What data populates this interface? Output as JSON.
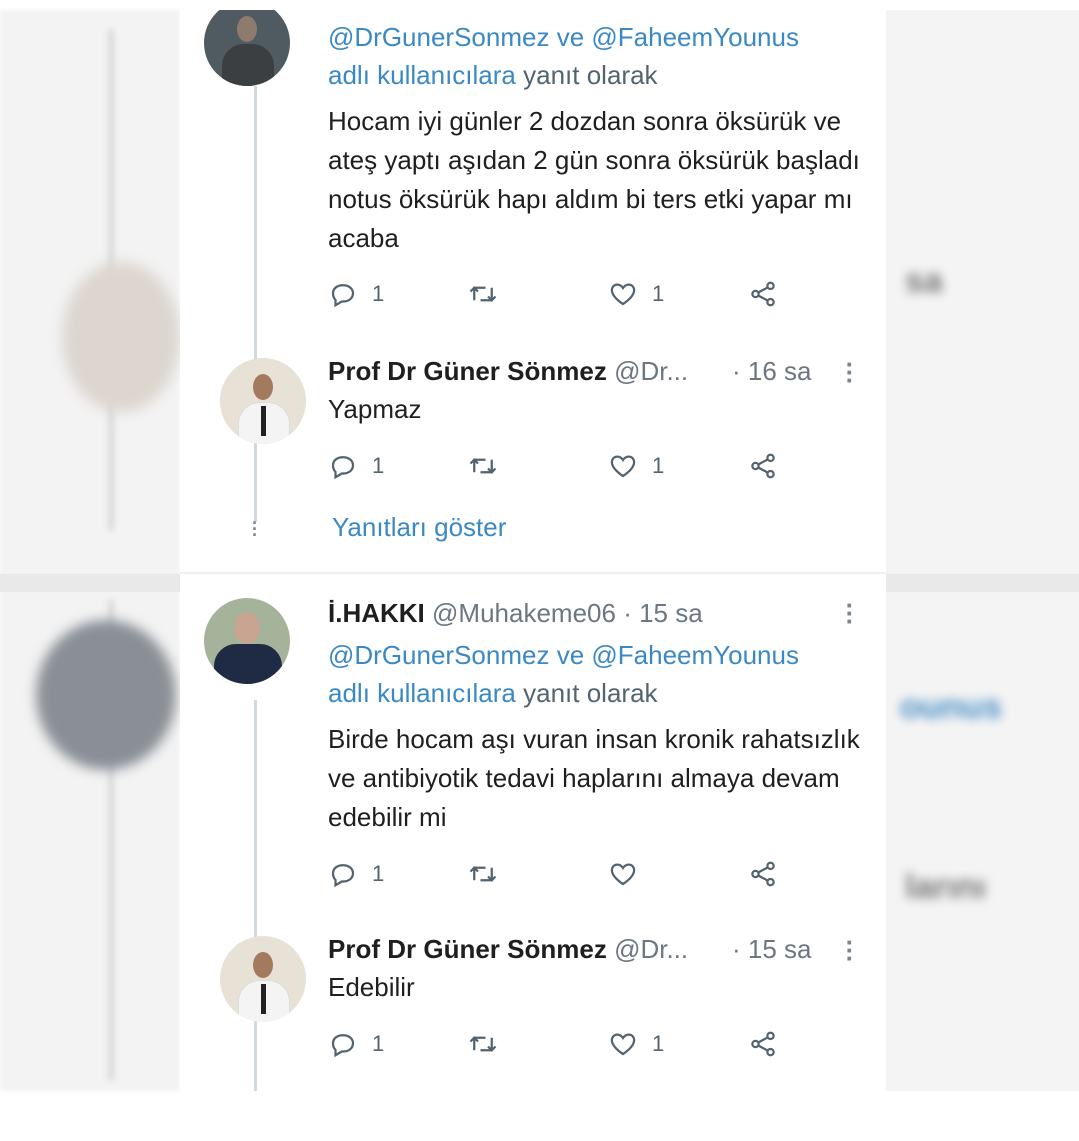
{
  "colors": {
    "link": "#3b89c4",
    "text": "#1f1f1f",
    "muted": "#536471"
  },
  "tweet1": {
    "reply_to_mentions": "@DrGunerSonmez ve @FaheemYounus",
    "reply_to_users": "adlı kullanıcılara",
    "reply_to_suffix": "yanıt olarak",
    "body": "Hocam iyi günler 2 dozdan sonra öksürük ve ateş yaptı aşıdan 2 gün sonra öksürük başladı notus öksürük hapı aldım bi ters etki yapar mı acaba",
    "reply_count": "1",
    "like_count": "1"
  },
  "reply1": {
    "author_name": "Prof Dr Güner Sönmez",
    "author_handle": "@Dr...",
    "time": "· 16 sa",
    "body": "Yapmaz",
    "reply_count": "1",
    "like_count": "1"
  },
  "show_replies": "Yanıtları göster",
  "tweet2": {
    "author_name": "İ.HAKKI",
    "author_handle": "@Muhakeme06",
    "time": "· 15 sa",
    "reply_to_mentions": "@DrGunerSonmez ve @FaheemYounus",
    "reply_to_users": "adlı kullanıcılara",
    "reply_to_suffix": "yanıt olarak",
    "body": "Birde hocam aşı vuran insan kronik rahatsızlık ve antibiyotik tedavi haplarını almaya devam edebilir mi",
    "reply_count": "1",
    "like_count": ""
  },
  "reply2": {
    "author_name": "Prof Dr Güner Sönmez",
    "author_handle": "@Dr...",
    "time": "· 15 sa",
    "body": "Edebilir",
    "reply_count": "1",
    "like_count": "1"
  },
  "background_blur": {
    "time_fragment": "sa",
    "mention_fragment": "ounus",
    "text_fragment": "larını"
  }
}
